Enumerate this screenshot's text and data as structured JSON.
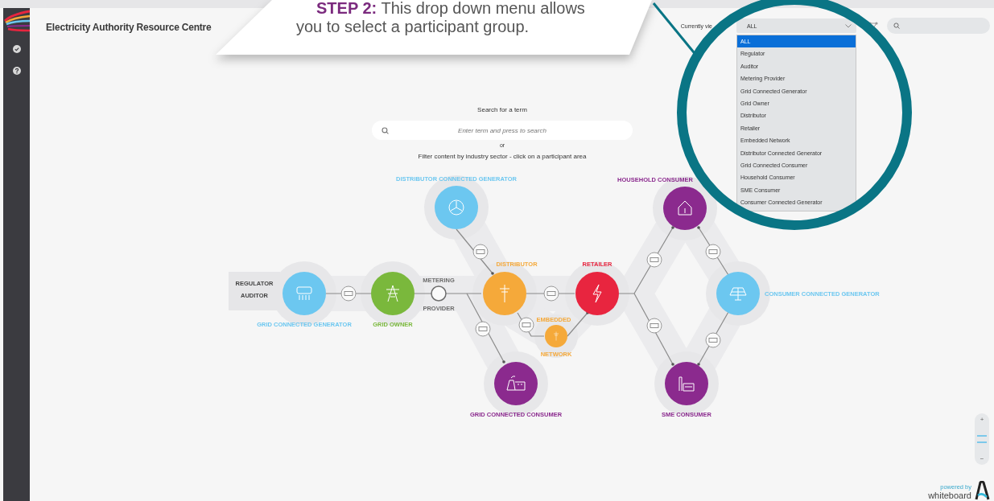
{
  "callout": {
    "step": "STEP 2:",
    "line_1": "This drop down menu allows",
    "line_2": "you to select a participant group."
  },
  "header": {
    "title": "Electricity Authority Resource Centre",
    "view_label": "Currently vie",
    "view_select": {
      "value": "ALL"
    }
  },
  "dropdown": {
    "options": [
      {
        "label": "ALL",
        "selected": true
      },
      {
        "label": "Regulator",
        "selected": false
      },
      {
        "label": "Auditor",
        "selected": false
      },
      {
        "label": "Metering Provider",
        "selected": false
      },
      {
        "label": "Grid Connected Generator",
        "selected": false
      },
      {
        "label": "Grid Owner",
        "selected": false
      },
      {
        "label": "Distributor",
        "selected": false
      },
      {
        "label": "Retailer",
        "selected": false
      },
      {
        "label": "Embedded Network",
        "selected": false
      },
      {
        "label": "Distributor Connected Generator",
        "selected": false
      },
      {
        "label": "Grid Connected Consumer",
        "selected": false
      },
      {
        "label": "Household Consumer",
        "selected": false
      },
      {
        "label": "SME Consumer",
        "selected": false
      },
      {
        "label": "Consumer Connected Generator",
        "selected": false
      }
    ]
  },
  "search_section": {
    "heading": "Search for a term",
    "placeholder": "Enter term and press to search",
    "or": "or",
    "filter_hint": "Filter content by industry sector - click on a participant area"
  },
  "diagram": {
    "side_labels": [
      "REGULATOR",
      "AUDITOR"
    ],
    "nodes": [
      {
        "kind": "large",
        "color": "#6cc7f0",
        "labels": [
          "DISTRIBUTOR CONNECTED GENERATOR"
        ]
      },
      {
        "kind": "large",
        "color": "#6cc7f0",
        "labels": [
          "GRID CONNECTED GENERATOR"
        ]
      },
      {
        "kind": "large",
        "color": "#7ab83c",
        "labels": [
          "GRID OWNER"
        ]
      },
      {
        "kind": "ring",
        "color": "#6d6d6d",
        "labels": [
          "METERING",
          "PROVIDER"
        ]
      },
      {
        "kind": "large",
        "color": "#f5a93a",
        "labels": [
          "DISTRIBUTOR"
        ]
      },
      {
        "kind": "small",
        "color": "#f5a93a",
        "labels": [
          "EMBEDDED",
          "NETWORK"
        ]
      },
      {
        "kind": "large",
        "color": "#e8253f",
        "labels": [
          "RETAILER"
        ]
      },
      {
        "kind": "large",
        "color": "#8b2a8e",
        "labels": [
          "GRID CONNECTED CONSUMER"
        ]
      },
      {
        "kind": "large",
        "color": "#8b2a8e",
        "labels": [
          "HOUSEHOLD CONSUMER"
        ]
      },
      {
        "kind": "large",
        "color": "#6cc7f0",
        "labels": [
          "CONSUMER CONNECTED GENERATOR"
        ]
      },
      {
        "kind": "large",
        "color": "#8b2a8e",
        "labels": [
          "SME CONSUMER"
        ]
      }
    ]
  },
  "zoom": {
    "plus": "+",
    "minus": "−"
  },
  "footer": {
    "powered_by": "powered by",
    "brand": "whiteboard"
  }
}
